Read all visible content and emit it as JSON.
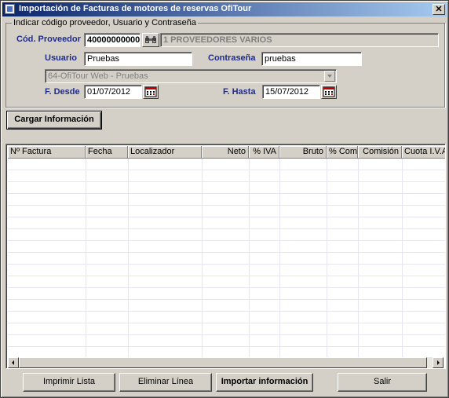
{
  "window": {
    "title": "Importación de Facturas de motores de reservas OfiTour",
    "close_symbol": "✕"
  },
  "group": {
    "legend": "Indicar código proveedor, Usuario y Contraseña"
  },
  "proveedor": {
    "label": "Cód. Proveedor",
    "code": "40000000000",
    "name": "1 PROVEEDORES VARIOS"
  },
  "usuario": {
    "label": "Usuario",
    "value": "Pruebas"
  },
  "contrasena": {
    "label": "Contraseña",
    "value": "pruebas"
  },
  "motor": {
    "selected": "64-OfiTour Web - Pruebas"
  },
  "fecha_desde": {
    "label": "F. Desde",
    "value": "01/07/2012"
  },
  "fecha_hasta": {
    "label": "F. Hasta",
    "value": "15/07/2012"
  },
  "cargar_button": "Cargar Información",
  "grid": {
    "columns": [
      "Nº Factura",
      "Fecha",
      "Localizador",
      "Neto",
      "% IVA",
      "Bruto",
      "% Com.",
      "Comisión",
      "Cuota I.V.A."
    ]
  },
  "footer": {
    "imprimir": "Imprimir Lista",
    "eliminar": "Eliminar Línea",
    "importar": "Importar información",
    "salir": "Salir"
  },
  "icons": {
    "binoculars": "binoculars-icon",
    "calendar": "calendar-icon"
  }
}
